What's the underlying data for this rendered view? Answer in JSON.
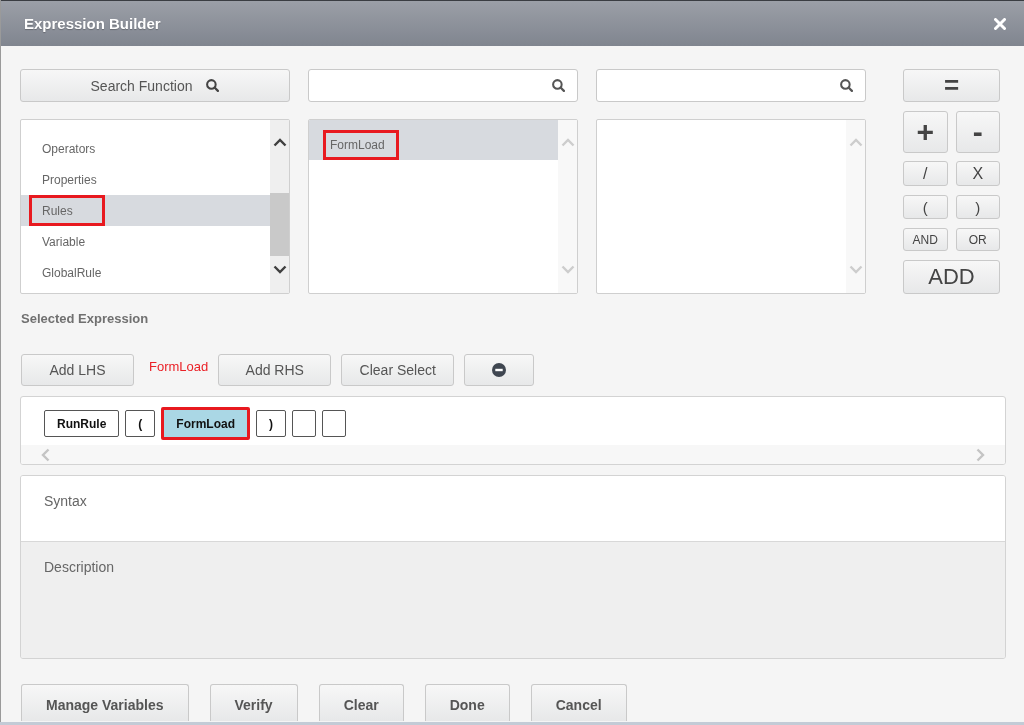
{
  "window": {
    "title": "Expression Builder"
  },
  "panels": [
    {
      "kind": "button",
      "search_label": "Search Function",
      "scroll_enabled": true,
      "items": [
        {
          "label": "Operators",
          "selected": false,
          "annotated": false
        },
        {
          "label": "Properties",
          "selected": false,
          "annotated": false
        },
        {
          "label": "Rules",
          "selected": true,
          "annotated": true
        },
        {
          "label": "Variable",
          "selected": false,
          "annotated": false
        },
        {
          "label": "GlobalRule",
          "selected": false,
          "annotated": false
        }
      ]
    },
    {
      "kind": "field",
      "scroll_enabled": false,
      "items": [
        {
          "label": "FormLoad",
          "selected": true,
          "annotated": true
        }
      ]
    },
    {
      "kind": "field",
      "scroll_enabled": false
    }
  ],
  "operator_rows": [
    [
      "="
    ],
    [
      "+",
      "-"
    ],
    [
      "/",
      "X"
    ],
    [
      "(",
      ")"
    ],
    [
      "AND",
      "OR"
    ],
    [
      "ADD"
    ]
  ],
  "selected_expression": {
    "heading": "Selected Expression",
    "tools": [
      {
        "kind": "button",
        "label": "Add LHS"
      },
      {
        "kind": "note",
        "label": "FormLoad"
      },
      {
        "kind": "button",
        "label": "Add RHS"
      },
      {
        "kind": "button",
        "label": "Clear Select"
      },
      {
        "kind": "remove"
      }
    ]
  },
  "expression": {
    "tokens": [
      {
        "kind": "text",
        "text": "RunRule",
        "selected": false,
        "annotated": false
      },
      {
        "kind": "text",
        "text": "(",
        "selected": false,
        "annotated": false
      },
      {
        "kind": "text",
        "text": "FormLoad",
        "selected": true,
        "annotated": true
      },
      {
        "kind": "text",
        "text": ")",
        "selected": false,
        "annotated": false
      },
      {
        "kind": "empty",
        "selected": false,
        "annotated": false
      },
      {
        "kind": "empty",
        "selected": false,
        "annotated": false
      }
    ]
  },
  "syntax": {
    "label": "Syntax"
  },
  "description": {
    "label": "Description"
  },
  "footer_buttons": [
    {
      "label": "Manage Variables"
    },
    {
      "label": "Verify"
    },
    {
      "label": "Clear"
    },
    {
      "label": "Done"
    },
    {
      "label": "Cancel"
    }
  ]
}
